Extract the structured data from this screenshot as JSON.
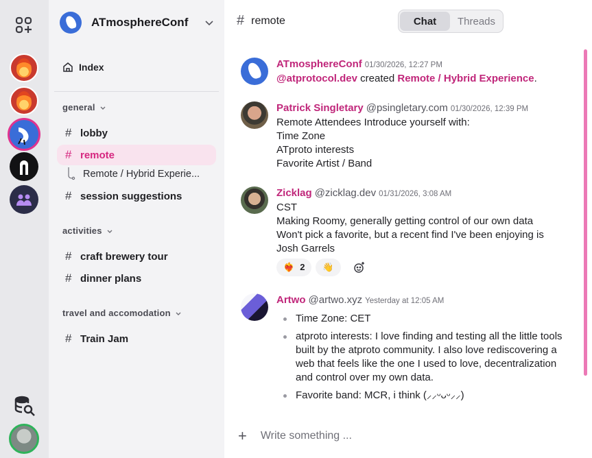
{
  "rail": {
    "icons": [
      "grid-plus-icon",
      "fire-server-icon",
      "fire-server-icon",
      "atmosphereconf-server-icon",
      "black-server-icon",
      "people-server-icon",
      "database-search-icon",
      "user-avatar"
    ]
  },
  "sidebar": {
    "space_name": "ATmosphereConf",
    "index_label": "Index",
    "sections": [
      {
        "label": "general",
        "channels": [
          "lobby",
          "remote",
          "session suggestions"
        ]
      },
      {
        "label": "activities",
        "channels": [
          "craft brewery tour",
          "dinner plans"
        ]
      },
      {
        "label": "travel and accomodation",
        "channels": [
          "Train Jam"
        ]
      }
    ],
    "thread_label": "Remote / Hybrid Experie..."
  },
  "header": {
    "channel": "remote",
    "tabs": [
      "Chat",
      "Threads"
    ],
    "active_tab": "Chat"
  },
  "messages": [
    {
      "author": "ATmosphereConf",
      "handle": "",
      "time": "01/30/2026, 12:27 PM",
      "mention": "@atprotocol.dev",
      "text_mid": " created ",
      "link": "Remote / Hybrid Experience",
      "text_end": "."
    },
    {
      "author": "Patrick Singletary",
      "handle": "@psingletary.com",
      "time": "01/30/2026, 12:39 PM",
      "lines": [
        "Remote Attendees Introduce yourself with:",
        "Time Zone",
        "ATproto interests",
        "Favorite Artist / Band"
      ]
    },
    {
      "author": "Zicklag",
      "handle": "@zicklag.dev",
      "time": "01/31/2026, 3:08 AM",
      "lines": [
        "CST",
        "Making Roomy, generally getting control of our own data",
        "Won't pick a favorite, but a recent find I've been enjoying is",
        "Josh Garrels"
      ],
      "reactions": [
        {
          "emoji": "❤️‍🔥",
          "count": "2"
        },
        {
          "emoji": "👋",
          "count": ""
        }
      ]
    },
    {
      "author": "Artwo",
      "handle": "@artwo.xyz",
      "time": "Yesterday at 12:05 AM",
      "bullets": [
        "Time Zone: CET",
        "atproto interests: I love finding and testing all the little tools built by the atproto community. I also love rediscovering a web that feels like the one I used to love, decentralization and control over my own data.",
        "Favorite band: MCR, i think (⸝⸝ᵕᴗᵕ⸝⸝)"
      ]
    }
  ],
  "composer": {
    "placeholder": "Write something ..."
  },
  "colors": {
    "accent": "#c0267a",
    "active_channel_bg": "#f9e3ee",
    "scrollbar": "#ec79b6"
  }
}
